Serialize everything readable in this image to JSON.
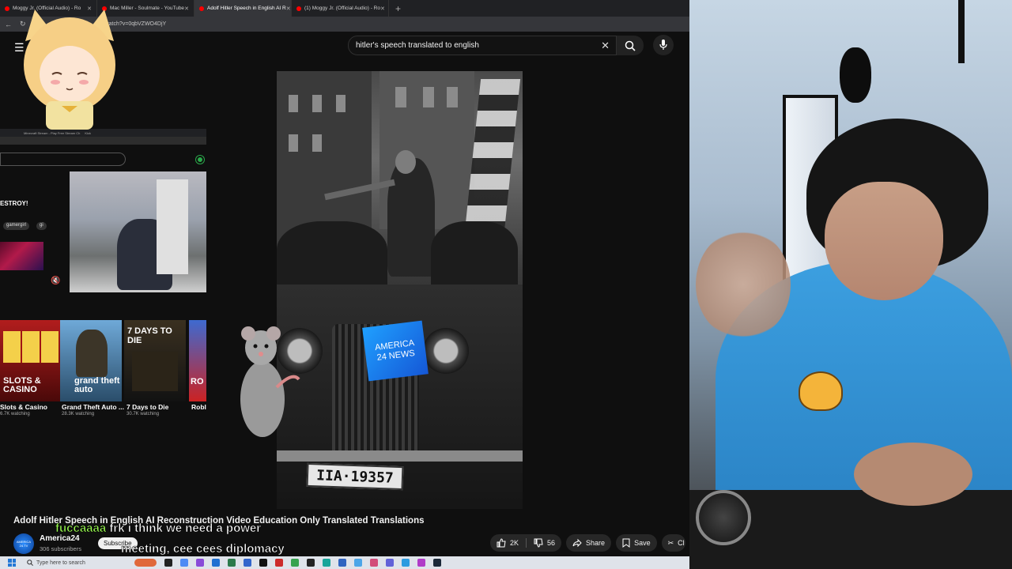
{
  "browser": {
    "tabs": [
      {
        "label": "Moggy Jr. (Official Audio) - Ro",
        "active": false
      },
      {
        "label": "Mac Miller - Soulmate - YouTube",
        "active": false
      },
      {
        "label": "Adolf Hitler Speech in English AI R",
        "active": true
      },
      {
        "label": "(1) Moggy Jr. (Official Audio) - Ro",
        "active": false
      }
    ],
    "url": "watch?v=0qbVZWO4DjY"
  },
  "search": {
    "query": "hitler's speech translated to english"
  },
  "video": {
    "plate": "IIA·19357",
    "badge_line1": "AMERICA",
    "badge_line2": "24 NEWS",
    "title": "Adolf Hitler Speech in English AI Reconstruction Video Education Only Translated Translations"
  },
  "channel": {
    "avatar_text": "AMERICA 24.TV",
    "name": "America24",
    "subscribers": "306 subscribers",
    "subscribe_label": "Subscribe"
  },
  "actions": {
    "likes": "2K",
    "dislikes": "56",
    "share": "Share",
    "save": "Save",
    "clip": "Cl"
  },
  "chat": {
    "user": "fuccaaaa",
    "line1": "frk i think we need a power",
    "line2": "meeting, cee cees diplomacy"
  },
  "embedded": {
    "tab_label": "Minecraft Stream - Play Free Stream Ch",
    "tab2_label": "Kick",
    "title_fragment": "ESTROY!",
    "tags": [
      "gamergirl",
      "gi"
    ],
    "games": [
      {
        "name": "Slots & Casino",
        "viewers": "6.7K watching"
      },
      {
        "name": "Grand Theft Auto ...",
        "viewers": "28.3K watching"
      },
      {
        "name": "7 Days to Die",
        "viewers": "30.7K watching"
      },
      {
        "name": "Roblox",
        "viewers": ""
      }
    ],
    "cover_slots": "SLOTS & CASINO",
    "cover_gta": "grand theft auto",
    "cover_7days": "7 DAYS TO DIE",
    "cover_roblox": "RO"
  },
  "taskbar": {
    "search_placeholder": "Type here to search"
  },
  "colors": {
    "youtube_bg": "#0f0f0f",
    "accent_red": "#ff0000",
    "chat_user": "#9cff52",
    "shirt": "#3c9fe0",
    "news_badge": "#1fa0ff"
  }
}
